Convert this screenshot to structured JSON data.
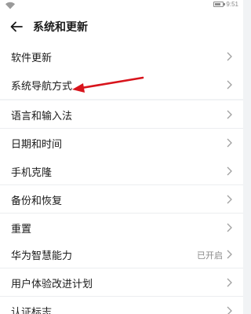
{
  "status": {
    "time": "9:51",
    "battery_level": 0.6
  },
  "header": {
    "title": "系统和更新",
    "back_icon": "arrow-left-icon"
  },
  "groups": [
    {
      "items": [
        {
          "label": "软件更新"
        }
      ]
    },
    {
      "items": [
        {
          "label": "系统导航方式"
        }
      ]
    },
    {
      "items": [
        {
          "label": "语言和输入法"
        },
        {
          "label": "日期和时间"
        }
      ]
    },
    {
      "items": [
        {
          "label": "手机克隆"
        },
        {
          "label": "备份和恢复"
        },
        {
          "label": "重置"
        }
      ]
    },
    {
      "items": [
        {
          "label": "华为智慧能力",
          "value": "已开启"
        },
        {
          "label": "用户体验改进计划"
        },
        {
          "label": "认证标志"
        }
      ]
    }
  ],
  "annotation": {
    "color": "#d8141c"
  }
}
